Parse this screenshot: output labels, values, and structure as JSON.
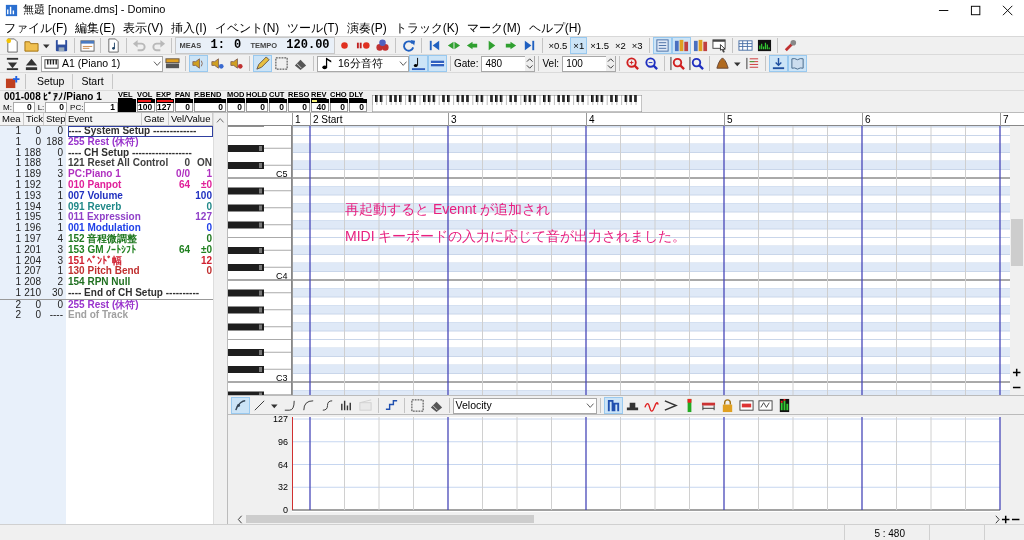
{
  "window": {
    "title": "無題 [noname.dms] - Domino"
  },
  "menu": [
    "ファイル(F)",
    "編集(E)",
    "表示(V)",
    "挿入(I)",
    "イベント(N)",
    "ツール(T)",
    "演奏(P)",
    "トラック(K)",
    "マーク(M)",
    "ヘルプ(H)"
  ],
  "toolbar_main": [
    {
      "kind": "icon",
      "selected": false,
      "disabled": false
    },
    {
      "kind": "icon",
      "selected": false,
      "disabled": false
    },
    {
      "kind": "icon",
      "selected": false,
      "disabled": false
    },
    {
      "kind": "icon",
      "selected": false,
      "disabled": false
    },
    {
      "kind": "separator"
    },
    {
      "kind": "icon",
      "selected": false,
      "disabled": false
    },
    {
      "kind": "separator"
    },
    {
      "kind": "icon",
      "selected": false,
      "disabled": false
    },
    {
      "kind": "separator"
    },
    {
      "kind": "icon",
      "selected": false,
      "disabled": true
    },
    {
      "kind": "icon",
      "selected": false,
      "disabled": true
    },
    {
      "kind": "separator"
    },
    {
      "kind": "position",
      "meas_label": "MEAS",
      "measure": "1:",
      "tick": "0",
      "tempo_label": "TEMPO",
      "tempo": "120.00"
    },
    {
      "kind": "icon",
      "selected": false,
      "disabled": false
    },
    {
      "kind": "icon",
      "selected": false,
      "disabled": false
    },
    {
      "kind": "icon",
      "selected": false,
      "disabled": false
    },
    {
      "kind": "separator"
    },
    {
      "kind": "icon",
      "selected": false,
      "disabled": false
    },
    {
      "kind": "separator"
    },
    {
      "kind": "icon",
      "selected": false,
      "disabled": false
    },
    {
      "kind": "icon",
      "selected": false,
      "disabled": false
    },
    {
      "kind": "icon",
      "selected": false,
      "disabled": false
    },
    {
      "kind": "icon",
      "selected": false,
      "disabled": false
    },
    {
      "kind": "icon",
      "selected": false,
      "disabled": false
    },
    {
      "kind": "icon",
      "selected": false,
      "disabled": false
    },
    {
      "kind": "separator"
    },
    {
      "kind": "toggle",
      "label": "×0.5",
      "selected": false
    },
    {
      "kind": "toggle",
      "label": "×1",
      "selected": true
    },
    {
      "kind": "toggle",
      "label": "×1.5",
      "selected": false
    },
    {
      "kind": "toggle",
      "label": "×2",
      "selected": false
    },
    {
      "kind": "toggle",
      "label": "×3",
      "selected": false
    },
    {
      "kind": "separator"
    },
    {
      "kind": "icon",
      "selected": true,
      "disabled": false
    },
    {
      "kind": "icon",
      "selected": true,
      "disabled": false
    },
    {
      "kind": "icon",
      "selected": false,
      "disabled": false
    },
    {
      "kind": "icon",
      "selected": false,
      "disabled": false
    },
    {
      "kind": "separator"
    },
    {
      "kind": "icon",
      "selected": false,
      "disabled": false
    },
    {
      "kind": "icon",
      "selected": false,
      "disabled": false
    },
    {
      "kind": "separator"
    },
    {
      "kind": "icon",
      "selected": false,
      "disabled": false
    }
  ],
  "toolbar_track": [
    {
      "kind": "icon",
      "selected": false,
      "disabled": false
    },
    {
      "kind": "icon",
      "selected": false,
      "disabled": false
    },
    {
      "kind": "combo",
      "value": "A1 (Piano 1)"
    },
    {
      "kind": "icon",
      "selected": false,
      "disabled": false
    },
    {
      "kind": "separator"
    },
    {
      "kind": "icon",
      "selected": true,
      "disabled": false
    },
    {
      "kind": "icon",
      "selected": false,
      "disabled": false
    },
    {
      "kind": "icon",
      "selected": false,
      "disabled": false
    },
    {
      "kind": "separator"
    },
    {
      "kind": "icon",
      "selected": true,
      "disabled": false
    },
    {
      "kind": "icon",
      "selected": false,
      "disabled": false
    },
    {
      "kind": "icon",
      "selected": false,
      "disabled": false
    },
    {
      "kind": "separator"
    },
    {
      "kind": "combo",
      "value": "16分音符"
    },
    {
      "kind": "icon",
      "selected": true,
      "disabled": false
    },
    {
      "kind": "icon",
      "selected": true,
      "disabled": false
    },
    {
      "kind": "separator"
    },
    {
      "kind": "spin",
      "label": "Gate:",
      "value": "480"
    },
    {
      "kind": "separator"
    },
    {
      "kind": "spin",
      "label": "Vel:",
      "value": "100"
    },
    {
      "kind": "separator"
    },
    {
      "kind": "icon",
      "selected": false,
      "disabled": false
    },
    {
      "kind": "icon",
      "selected": false,
      "disabled": false
    },
    {
      "kind": "separator"
    },
    {
      "kind": "icon",
      "selected": false,
      "disabled": false
    },
    {
      "kind": "icon",
      "selected": false,
      "disabled": false
    },
    {
      "kind": "separator"
    },
    {
      "kind": "icon",
      "selected": false,
      "disabled": false
    },
    {
      "kind": "icon",
      "selected": false,
      "disabled": false
    },
    {
      "kind": "icon",
      "selected": false,
      "disabled": false
    },
    {
      "kind": "separator"
    },
    {
      "kind": "icon",
      "selected": true,
      "disabled": false
    },
    {
      "kind": "icon",
      "selected": true,
      "disabled": false
    }
  ],
  "marker_bar": [
    {
      "kind": "icon",
      "selected": false,
      "disabled": false
    },
    {
      "kind": "separator"
    },
    {
      "kind": "marker",
      "label": "Setup"
    },
    {
      "kind": "marker",
      "label": "Start"
    }
  ],
  "track_info": {
    "name": "001-008 ﾋﾟｱﾉ/Piano 1",
    "fields": [
      {
        "label": "M:",
        "value": "0"
      },
      {
        "label": "L:",
        "value": "0"
      },
      {
        "label": "PC:",
        "value": "1"
      }
    ],
    "meters": [
      {
        "label": "VEL"
      },
      {
        "label": "VOL",
        "value": "100",
        "level": 0.79,
        "color": "#ee1c1c"
      },
      {
        "label": "EXP",
        "value": "127",
        "level": 1,
        "color": "#ee1c1c"
      },
      {
        "label": "PAN",
        "value": "0"
      },
      {
        "label": "P.BEND",
        "value": "0"
      },
      {
        "label": "MOD",
        "value": "0"
      },
      {
        "label": "HOLD",
        "value": "0"
      },
      {
        "label": "CUT",
        "value": "0"
      },
      {
        "label": "RESO",
        "value": "0"
      },
      {
        "label": "REV",
        "value": "40",
        "level": 0.31,
        "color": "#f4f07a"
      },
      {
        "label": "CHO",
        "value": "0"
      },
      {
        "label": "DLY",
        "value": "0"
      }
    ]
  },
  "event_list": {
    "columns": [
      "Mea",
      "Tick",
      "Step",
      "Event",
      "Gate",
      "Vel/Value"
    ],
    "rows": [
      {
        "mea": "1",
        "tick": "0",
        "step": "0",
        "event": "---- System Setup -------------",
        "color": "#303030",
        "selected": true
      },
      {
        "mea": "1",
        "tick": "0",
        "step": "188",
        "event": "255 Rest (休符)",
        "color": "#9933cc",
        "selected": false
      },
      {
        "mea": "1",
        "tick": "188",
        "step": "0",
        "event": "---- CH Setup ------------------",
        "color": "#303030",
        "selected": false
      },
      {
        "mea": "1",
        "tick": "188",
        "step": "1",
        "event": "121 Reset All Control",
        "gate": "0",
        "value": "ON",
        "color": "#404040",
        "selected": false
      },
      {
        "mea": "1",
        "tick": "189",
        "step": "3",
        "event": "PC:Piano 1",
        "gate": "0/0",
        "value": "1",
        "color": "#b030c0",
        "selected": false
      },
      {
        "mea": "1",
        "tick": "192",
        "step": "1",
        "event": "010 Panpot",
        "gate": "64",
        "value": "±0",
        "color": "#e0209a",
        "selected": false
      },
      {
        "mea": "1",
        "tick": "193",
        "step": "1",
        "event": "007 Volume",
        "value": "100",
        "color": "#2030c0",
        "selected": false
      },
      {
        "mea": "1",
        "tick": "194",
        "step": "1",
        "event": "091 Reverb",
        "value": "0",
        "color": "#208888",
        "selected": false
      },
      {
        "mea": "1",
        "tick": "195",
        "step": "1",
        "event": "011 Expression",
        "value": "127",
        "color": "#9040c8",
        "selected": false
      },
      {
        "mea": "1",
        "tick": "196",
        "step": "1",
        "event": "001 Modulation",
        "value": "0",
        "color": "#2040e8",
        "selected": false
      },
      {
        "mea": "1",
        "tick": "197",
        "step": "4",
        "event": "152 音程微調整",
        "value": "0",
        "color": "#207820",
        "selected": false
      },
      {
        "mea": "1",
        "tick": "201",
        "step": "3",
        "event": "153 GM ﾉｰﾄｼﾌﾄ",
        "gate": "64",
        "value": "±0",
        "color": "#208020",
        "selected": false
      },
      {
        "mea": "1",
        "tick": "204",
        "step": "3",
        "event": "151 ﾍﾞﾝﾄﾞ幅",
        "value": "12",
        "color": "#d02030",
        "selected": false
      },
      {
        "mea": "1",
        "tick": "207",
        "step": "1",
        "event": "130 Pitch Bend",
        "value": "0",
        "color": "#c03030",
        "selected": false
      },
      {
        "mea": "1",
        "tick": "208",
        "step": "2",
        "event": "154 RPN Null",
        "color": "#207020",
        "selected": false
      },
      {
        "mea": "1",
        "tick": "210",
        "step": "30",
        "event": "---- End of CH Setup ----------",
        "color": "#303030",
        "selected": false
      },
      {
        "mea": "2",
        "tick": "0",
        "step": "0",
        "event": "255 Rest (休符)",
        "color": "#9933cc",
        "selected": false
      },
      {
        "mea": "2",
        "tick": "0",
        "step": "----",
        "event": "End of Track",
        "color": "#a0a0a0",
        "selected": false
      }
    ]
  },
  "piano_roll": {
    "measures": [
      "1",
      "2 Start",
      "3",
      "4",
      "5",
      "6",
      "7"
    ],
    "octave_labels": [
      "C5",
      "C4",
      "C3"
    ],
    "annotation": [
      "再起動すると Evennt が追加され",
      "MIDI キーボードの入力に応じて音が出力されました。"
    ]
  },
  "velocity_pane": {
    "toolbar": [
      {
        "kind": "icon",
        "selected": true,
        "disabled": false
      },
      {
        "kind": "icon",
        "selected": false,
        "disabled": false
      },
      {
        "kind": "icon",
        "selected": false,
        "disabled": false
      },
      {
        "kind": "icon",
        "selected": false,
        "disabled": false
      },
      {
        "kind": "icon",
        "selected": false,
        "disabled": false
      },
      {
        "kind": "icon",
        "selected": false,
        "disabled": false
      },
      {
        "kind": "icon",
        "selected": false,
        "disabled": false
      },
      {
        "kind": "icon",
        "selected": false,
        "disabled": true
      },
      {
        "kind": "separator"
      },
      {
        "kind": "icon",
        "selected": false,
        "disabled": false
      },
      {
        "kind": "separator"
      },
      {
        "kind": "icon",
        "selected": false,
        "disabled": false
      },
      {
        "kind": "icon",
        "selected": false,
        "disabled": false
      },
      {
        "kind": "separator"
      },
      {
        "kind": "combo",
        "value": "Velocity"
      },
      {
        "kind": "separator"
      },
      {
        "kind": "icon",
        "selected": true,
        "disabled": false
      },
      {
        "kind": "icon",
        "selected": false,
        "disabled": false
      },
      {
        "kind": "icon",
        "selected": false,
        "disabled": false
      },
      {
        "kind": "icon",
        "selected": false,
        "disabled": false
      },
      {
        "kind": "icon",
        "selected": false,
        "disabled": false
      },
      {
        "kind": "icon",
        "selected": false,
        "disabled": false
      },
      {
        "kind": "icon",
        "selected": false,
        "disabled": false
      },
      {
        "kind": "icon",
        "selected": false,
        "disabled": false
      },
      {
        "kind": "icon",
        "selected": false,
        "disabled": false
      },
      {
        "kind": "icon",
        "selected": false,
        "disabled": false
      }
    ],
    "axis_labels": [
      "127",
      "96",
      "64",
      "32",
      "0"
    ]
  },
  "status_bar": {
    "position": "5 : 480"
  }
}
